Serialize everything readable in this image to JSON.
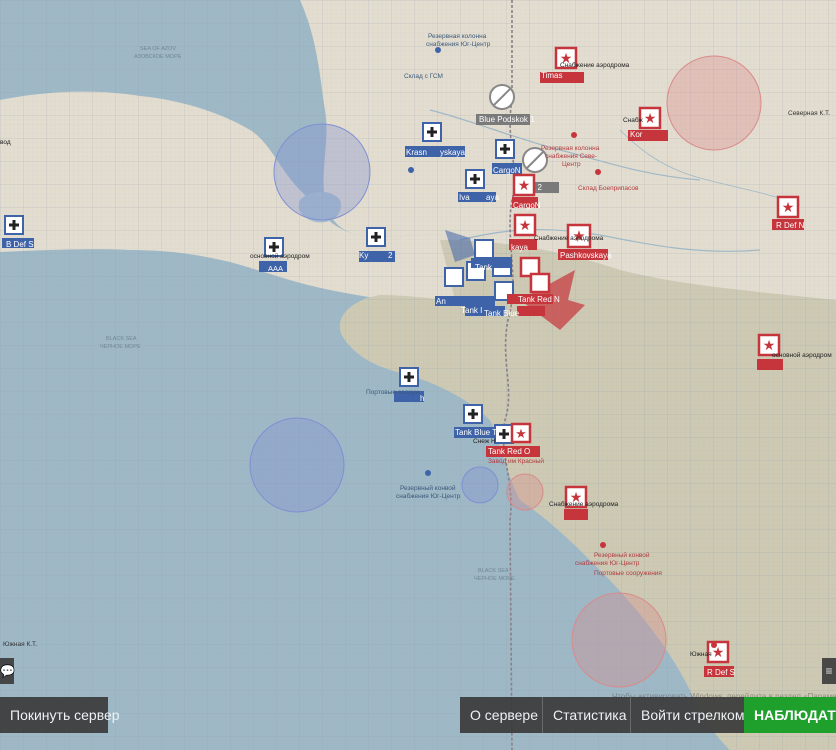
{
  "map": {
    "colors": {
      "sea": "#9fb8c6",
      "land": "#e3ddd0",
      "land_south": "#cdc9b3",
      "blue_unit": "#3f63a8",
      "red_unit": "#c7353c",
      "blue_zone": "#7f8fd2",
      "red_zone": "#d98a8a",
      "grid": "#8ea0ae",
      "front_line": "#8a7f86"
    },
    "map_labels": [
      {
        "id": "rezerv-n",
        "text": "Резервная колонна",
        "color": "#3b5a7a"
      },
      {
        "id": "rezerv-n2",
        "text": "снабжения Юг-Центр",
        "color": "#3b5a7a"
      },
      {
        "id": "sklad-gsm",
        "text": "Склад с ГСМ",
        "color": "#3b5a7a"
      },
      {
        "id": "sever-kt",
        "text": "Северная К.Т.",
        "color": "#333333"
      },
      {
        "id": "rezerv-sever",
        "text": "Резервная колонна",
        "color": "#b33a3f"
      },
      {
        "id": "rezerv-sever2",
        "text": "снабжения Севе-",
        "color": "#b33a3f"
      },
      {
        "id": "rezerv-sever3",
        "text": "Центр",
        "color": "#b33a3f"
      },
      {
        "id": "sklad-boepripasov",
        "text": "Склад Боеприпасов",
        "color": "#b33a3f"
      },
      {
        "id": "blue-podskok-1",
        "text": "Blue Podskok 1",
        "color": "#ffffff"
      },
      {
        "id": "podskok-2",
        "text": "lskok 2",
        "color": "#ffffff"
      },
      {
        "id": "cargo-n",
        "text": "CargoN",
        "color": "#ffffff"
      },
      {
        "id": "b-def-s",
        "text": "B Def S",
        "color": "#ffffff"
      },
      {
        "id": "r-def-n",
        "text": "R Def N",
        "color": "#ffffff"
      },
      {
        "id": "r-def-s",
        "text": "R Def S",
        "color": "#ffffff"
      },
      {
        "id": "tank-red-n",
        "text": "Tank Red N",
        "color": "#ffffff"
      },
      {
        "id": "tank-blue",
        "text": "Tank Blue",
        "color": "#ffffff"
      },
      {
        "id": "tank-red-o",
        "text": "Tank Red O",
        "color": "#ffffff"
      },
      {
        "id": "tank-blue-t",
        "text": "Tank Blue T",
        "color": "#ffffff"
      },
      {
        "id": "pashkovskaya",
        "text": "Pashkovskaya",
        "color": "#ffffff"
      },
      {
        "id": "krasnaya",
        "text": "Krasn",
        "color": "#ffffff"
      },
      {
        "id": "kaya",
        "text": "yskaya",
        "color": "#ffffff"
      },
      {
        "id": "timash",
        "text": "Timas",
        "color": "#ffffff"
      },
      {
        "id": "koren",
        "text": "Kor",
        "color": "#ffffff"
      },
      {
        "id": "kaya2",
        "text": "kaya",
        "color": "#ffffff"
      },
      {
        "id": "ivan",
        "text": "Iva",
        "color": "#ffffff"
      },
      {
        "id": "cargo-n-blue",
        "text": "CargoN",
        "color": "#ffffff"
      },
      {
        "id": "aaa",
        "text": "AAA",
        "color": "#ffffff"
      },
      {
        "id": "osnovnoy-aerodrom",
        "text": "основной аэродром",
        "color": "#222222"
      },
      {
        "id": "snabzh-aerodroma",
        "text": "Снабжение аэродрома",
        "color": "#222222"
      },
      {
        "id": "snabzh-a2",
        "text": "Снабж",
        "color": "#222222"
      },
      {
        "id": "snabzh-a3",
        "text": "Снабжение аэродрома",
        "color": "#222222"
      },
      {
        "id": "snabzh-a4",
        "text": "Снабжение аэродрома",
        "color": "#222222"
      },
      {
        "id": "portovye-b",
        "text": "Портовые сооруж",
        "color": "#3b5a7a"
      },
      {
        "id": "snezhny",
        "text": "Снеж Н",
        "color": "#222222"
      },
      {
        "id": "zavod-krasnyi",
        "text": "Завод им Красный",
        "color": "#b33a3f"
      },
      {
        "id": "rezerv-yug",
        "text": "Резервный конвой",
        "color": "#3b5a7a"
      },
      {
        "id": "rezerv-yug2",
        "text": "снабжения Юг-Центр",
        "color": "#3b5a7a"
      },
      {
        "id": "rezerv-yug-red",
        "text": "Резервный конвой",
        "color": "#b33a3f"
      },
      {
        "id": "rezerv-yug-red2",
        "text": "снабжения Юг-Центр",
        "color": "#b33a3f"
      },
      {
        "id": "portovye-red",
        "text": "Портовые сооружения",
        "color": "#b33a3f"
      },
      {
        "id": "yuzhnaya",
        "text": "Южная",
        "color": "#222222"
      },
      {
        "id": "yuzhnaya-kt",
        "text": "Южная К.Т.",
        "color": "#333333"
      },
      {
        "id": "black-sea-1",
        "text": "BLACK SEA",
        "color": "#6f8797"
      },
      {
        "id": "black-sea-2",
        "text": "ЧЕРНОЕ МОРЕ",
        "color": "#6f8797"
      },
      {
        "id": "black-sea-3",
        "text": "BLACK SEA",
        "color": "#6f8797"
      },
      {
        "id": "black-sea-4",
        "text": "ЧЕРНОЕ МОРЕ",
        "color": "#6f8797"
      },
      {
        "id": "sea-azov-1",
        "text": "SEA OF AZOV",
        "color": "#6f8797"
      },
      {
        "id": "sea-azov-2",
        "text": "АЗОВСКОЕ МОРЕ",
        "color": "#6f8797"
      },
      {
        "id": "azov-vod",
        "text": "вод",
        "color": "#222222"
      },
      {
        "id": "osnovnoy-bl",
        "text": "основной аэродром",
        "color": "#222222"
      },
      {
        "id": "ivan-kaya",
        "text": "aya",
        "color": "#ffffff"
      },
      {
        "id": "ko-2",
        "text": "Ky",
        "color": "#ffffff"
      },
      {
        "id": "ko-3",
        "text": "2",
        "color": "#ffffff"
      },
      {
        "id": "aksai",
        "text": "An",
        "color": "#ffffff"
      },
      {
        "id": "tank-i",
        "text": "Tank I",
        "color": "#ffffff"
      },
      {
        "id": "tank-b2",
        "text": "Tank",
        "color": "#ffffff"
      },
      {
        "id": "ob-h",
        "text": "h",
        "color": "#ffffff"
      }
    ]
  },
  "ui": {
    "leave_server": "Покинуть сервер",
    "about_server": "О сервере",
    "statistics": "Статистика",
    "join_gunner": "Войти стрелком",
    "observe": "НАБЛЮДАТЬ",
    "chat_icon": "chat-icon",
    "menu_icon": "menu-lines-icon",
    "watermark": "Чтобы активировать Windows, перейдите в раздел «Параметры»."
  }
}
